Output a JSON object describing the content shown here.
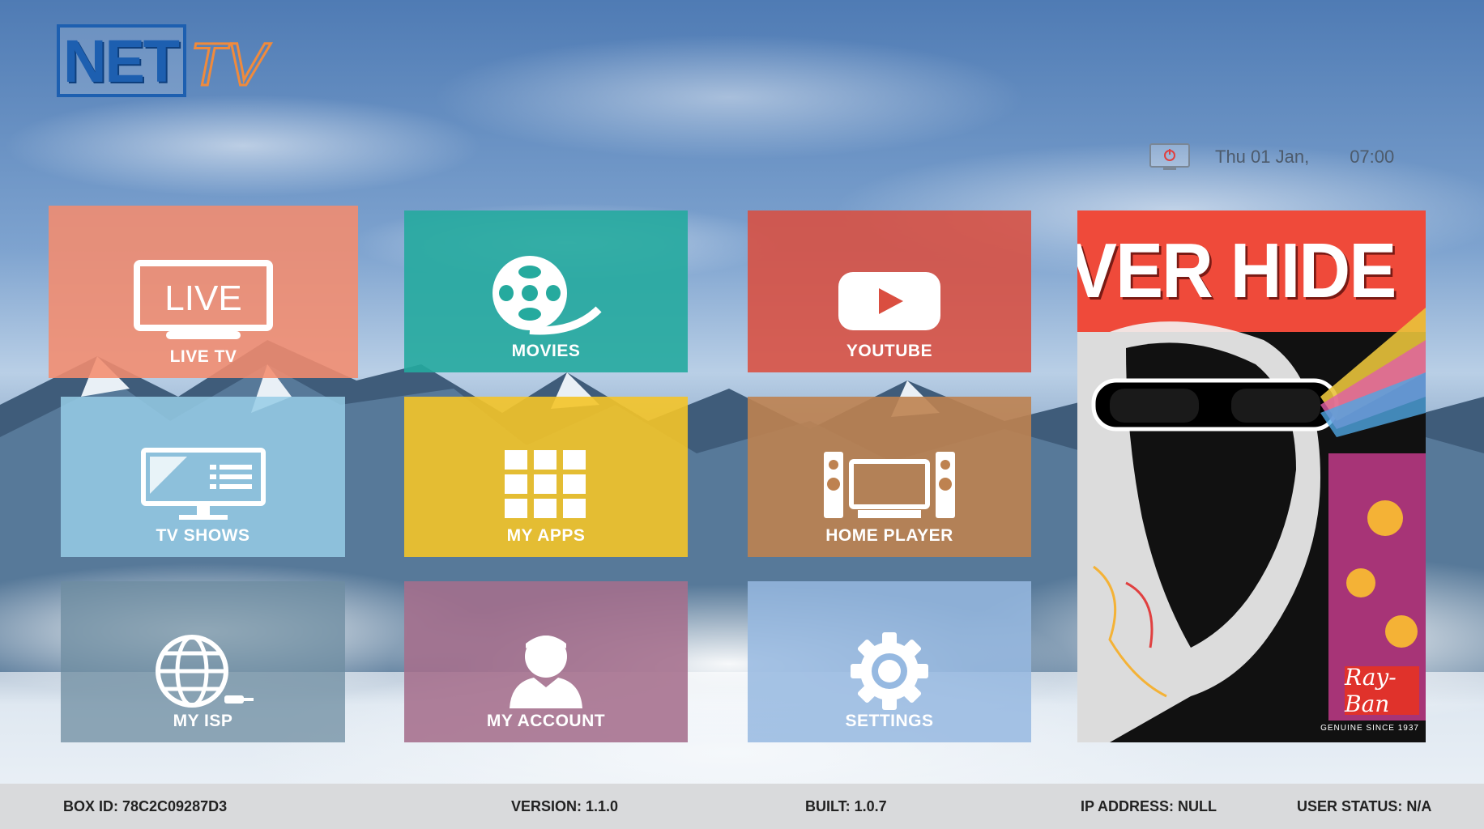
{
  "logo": {
    "net": "NET",
    "tv": "TV"
  },
  "clock": {
    "date": "Thu 01 Jan,",
    "time": "07:00"
  },
  "tiles": [
    {
      "label": "LIVE TV",
      "icon_text": "LIVE"
    },
    {
      "label": "MOVIES"
    },
    {
      "label": "YOUTUBE"
    },
    {
      "label": "TV SHOWS"
    },
    {
      "label": "MY APPS"
    },
    {
      "label": "HOME PLAYER"
    },
    {
      "label": "MY ISP"
    },
    {
      "label": "MY ACCOUNT"
    },
    {
      "label": "SETTINGS"
    }
  ],
  "promo": {
    "headline": "VER HIDE",
    "brand": "Ray-Ban",
    "brand_tagline": "GENUINE SINCE 1937"
  },
  "status": {
    "box_id": "BOX ID: 78C2C09287D3",
    "version": "VERSION: 1.1.0",
    "built": "BUILT: 1.0.7",
    "ip": "IP ADDRESS: NULL",
    "user": "USER STATUS: N/A"
  },
  "colors": {
    "live": "#f48c6e",
    "movies": "#25aa9e",
    "youtube": "#da4e40",
    "shows": "#96cde6",
    "apps": "#f4c428",
    "player": "#be8250",
    "isp": "#6e8ca0",
    "account": "#a56e8c",
    "settings": "#96b9e1"
  }
}
